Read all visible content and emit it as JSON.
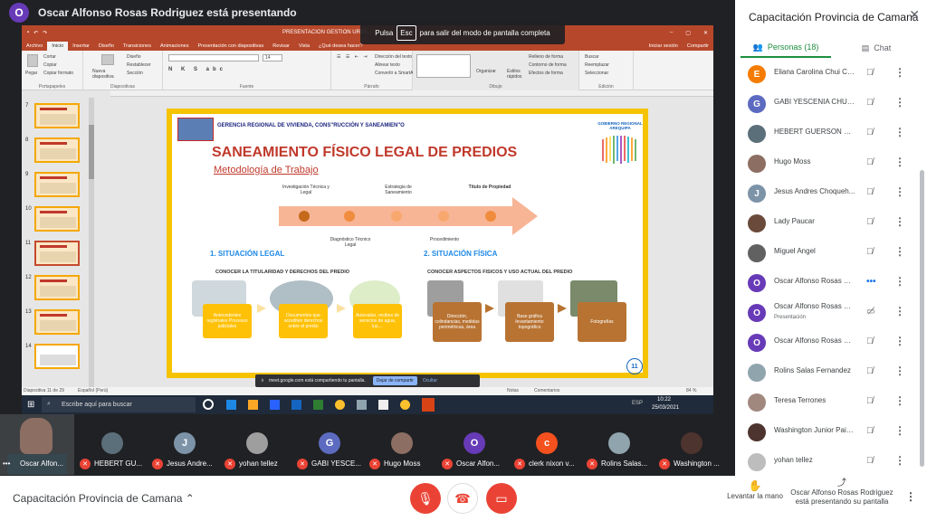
{
  "top": {
    "presenter_initial": "O",
    "presenting_text": "Oscar Alfonso Rosas Rodriguez está presentando"
  },
  "esc_tip": {
    "pre": "Pulsa",
    "key": "Esc",
    "post": "para salir del modo de pantalla completa"
  },
  "ppt": {
    "window_title": "PRESENTACION GESTION URBA...",
    "tabs": [
      "Archivo",
      "Inicio",
      "Insertar",
      "Diseño",
      "Transiciones",
      "Animaciones",
      "Presentación con diapositivas",
      "Revisar",
      "Vista",
      "¿Qué desea hacer?"
    ],
    "signin": "Iniciar sesión",
    "share": "Compartir",
    "groups": [
      "Portapapeles",
      "Diapositivas",
      "Fuente",
      "Párrafo",
      "Dibujo",
      "Edición"
    ],
    "clip": [
      "Pegar",
      "Cortar",
      "Copiar",
      "Copiar formato"
    ],
    "slides_grp": [
      "Nueva diapositiva",
      "Diseño",
      "Restablecer",
      "Sección"
    ],
    "para": [
      "Dirección del texto",
      "Alinear texto",
      "Convertir a SmartArt"
    ],
    "draw": [
      "Organizar",
      "Estilos rápidos",
      "Relleno de forma",
      "Contorno de forma",
      "Efectos de forma"
    ],
    "edit": [
      "Buscar",
      "Reemplazar",
      "Seleccionar"
    ],
    "font_size": "14",
    "thumb_numbers": [
      "7",
      "8",
      "9",
      "10",
      "11",
      "12",
      "13",
      "14"
    ],
    "status_left": "Diapositiva 11 de 29",
    "status_lang": "Español (Perú)",
    "status_notes": "Notas",
    "status_comments": "Comentarios",
    "zoom": "84 %",
    "taskbar": {
      "search": "Escribe aquí para buscar",
      "time": "10:22",
      "date": "25/03/2021",
      "lang": "ESP"
    }
  },
  "slide": {
    "header": "GERENCIA REGIONAL DE VIVIENDA, CONS\"RUCCIÓN Y SANEAMIEN\"O",
    "logo_text": "GOBIERNO REGIONAL AREQUIPA",
    "title": "SANEAMIENTO FÍSICO LEGAL DE PREDIOS",
    "subtitle": "Metodología de Trabajo",
    "steps_top": [
      "Investigación Técnica y Legal",
      "Estrategia de Saneamiento",
      "Título de Propiedad"
    ],
    "steps_bottom": [
      "Diagnóstico Técnico Legal",
      "Procedimiento"
    ],
    "sec1": "1. SITUACIÓN LEGAL",
    "sec2": "2. SITUACIÓN FÍSICA",
    "sec1_sub": "CONOCER LA TITULARIDAD Y  DERECHOS DEL PREDIO",
    "sec2_sub": "CONOCER ASPECTOS FISICOS Y USO ACTUAL DEL PREDIO",
    "legal_boxes": [
      "Antecedentes registrales Procesos judiciales",
      "Documentos que acrediten derechos sobre el predio",
      "Autovalúo, recibos de servicios de agua, luz,..."
    ],
    "phys_boxes": [
      "Dirección, colindancias, medidas perimétricas, área",
      "Base gráfica levantamiento topográfico",
      "Fotografías"
    ],
    "page_number": "11"
  },
  "share_bar": {
    "text": "meet.google.com está compartiendo tu pantalla.",
    "stop": "Dejar de compartir",
    "hide": "Ocultar"
  },
  "tiles": [
    {
      "name": "Oscar Alfon...",
      "initial": "",
      "color": "#6d5a4a"
    },
    {
      "name": "HEBERT GU...",
      "initial": "",
      "color": "#5b6f7a"
    },
    {
      "name": "Jesus Andre...",
      "initial": "J",
      "color": "#7c93a8"
    },
    {
      "name": "yohan tellez",
      "initial": "",
      "color": "#9e9e9e"
    },
    {
      "name": "GABI YESCE...",
      "initial": "G",
      "color": "#5c6bc0"
    },
    {
      "name": "Hugo Moss",
      "initial": "",
      "color": "#8d6e63"
    },
    {
      "name": "Oscar Alfon...",
      "initial": "O",
      "color": "#673ab7"
    },
    {
      "name": "clerk nixon v...",
      "initial": "c",
      "color": "#f4511e"
    },
    {
      "name": "Rolins Salas...",
      "initial": "",
      "color": "#90a4ae"
    },
    {
      "name": "Washington ...",
      "initial": "",
      "color": "#4e342e"
    }
  ],
  "bottom": {
    "meeting": "Capacitación Provincia de Camana",
    "raise": "Levantar la mano",
    "presenting": "Oscar Alfonso Rosas Rodriguez está presentando su pantalla"
  },
  "side": {
    "title": "Capacitación Provincia de Camana",
    "people_tab": "Personas (18)",
    "chat_tab": "Chat",
    "people": [
      {
        "name": "Eliana Carolina Chui Ch...",
        "initial": "E",
        "color": "#f57c00",
        "sub": ""
      },
      {
        "name": "GABI YESCENIA CHUI C...",
        "initial": "G",
        "color": "#5c6bc0",
        "sub": ""
      },
      {
        "name": "HEBERT GUERSON CC...",
        "initial": "",
        "color": "#5b6f7a",
        "sub": ""
      },
      {
        "name": "Hugo Moss",
        "initial": "",
        "color": "#8d6e63",
        "sub": ""
      },
      {
        "name": "Jesus Andres Choqueh...",
        "initial": "J",
        "color": "#7c93a8",
        "sub": ""
      },
      {
        "name": "Lady Paucar",
        "initial": "",
        "color": "#6a4a3a",
        "sub": ""
      },
      {
        "name": "Miguel Angel",
        "initial": "",
        "color": "#616161",
        "sub": ""
      },
      {
        "name": "Oscar Alfonso Rosas Ro...",
        "initial": "O",
        "color": "#673ab7",
        "sub": ""
      },
      {
        "name": "Oscar Alfonso Rosas Ro...",
        "initial": "O",
        "color": "#673ab7",
        "sub": "Presentación"
      },
      {
        "name": "Oscar Alfonso Rosas Ro...",
        "initial": "O",
        "color": "#673ab7",
        "sub": ""
      },
      {
        "name": "Rolins Salas Fernandez",
        "initial": "",
        "color": "#90a4ae",
        "sub": ""
      },
      {
        "name": "Teresa Terrones",
        "initial": "",
        "color": "#a1887f",
        "sub": ""
      },
      {
        "name": "Washington Junior Paiz...",
        "initial": "",
        "color": "#4e342e",
        "sub": ""
      },
      {
        "name": "yohan tellez",
        "initial": "",
        "color": "#bdbdbd",
        "sub": ""
      }
    ]
  }
}
